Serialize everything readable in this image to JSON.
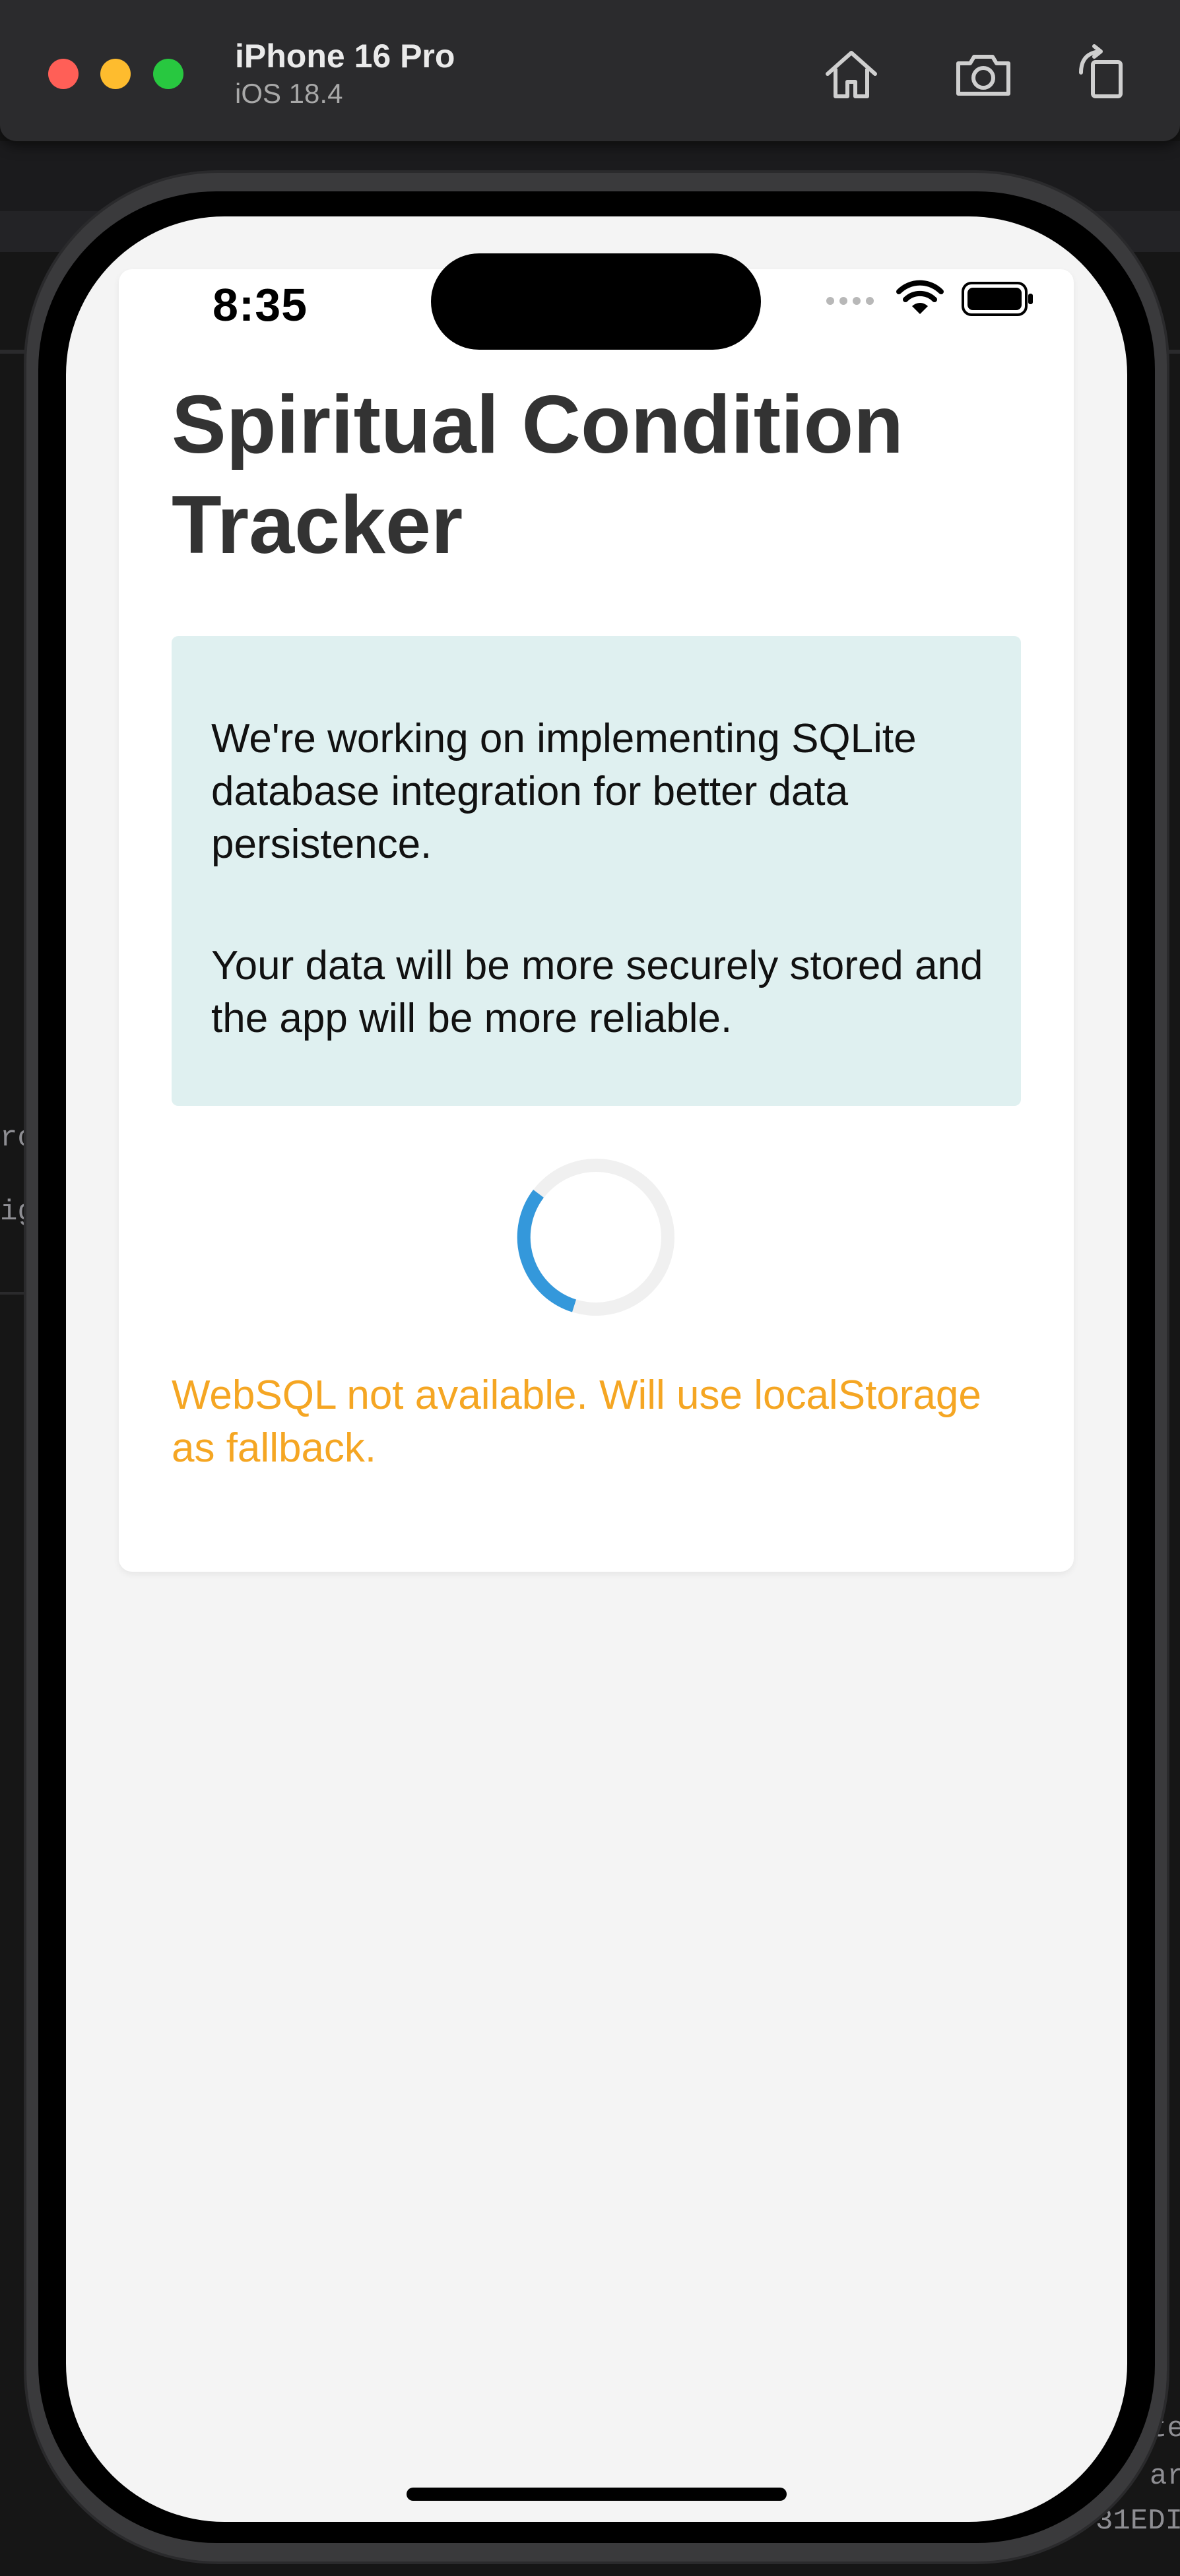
{
  "simulator": {
    "device_name": "iPhone 16 Pro",
    "os_version": "iOS 18.4",
    "toolbar": {
      "home_icon": "home-icon",
      "screenshot_icon": "camera-icon",
      "rotate_icon": "rotate-icon"
    }
  },
  "background": {
    "code_fragments": [
      "te",
      "ar",
      "31EDI",
      "ro",
      "ig"
    ]
  },
  "status_bar": {
    "time": "8:35",
    "signal_icon": "cellular-signal-icon",
    "wifi_icon": "wifi-icon",
    "battery_icon": "battery-icon"
  },
  "app": {
    "title": "Spiritual Condition Tracker",
    "info": {
      "paragraph_1": "We're working on implementing SQLite database integration for better data persistence.",
      "paragraph_2": "Your data will be more securely stored and the app will be more reliable."
    },
    "loading_spinner": "loading-spinner",
    "warning": "WebSQL not available. Will use localStorage as fallback."
  },
  "colors": {
    "title_text": "#333333",
    "info_background": "#dff0f0",
    "spinner_accent": "#3498db",
    "spinner_track": "#f0f0f0",
    "warning_text": "#f5a623",
    "screen_background": "#f4f4f4"
  }
}
